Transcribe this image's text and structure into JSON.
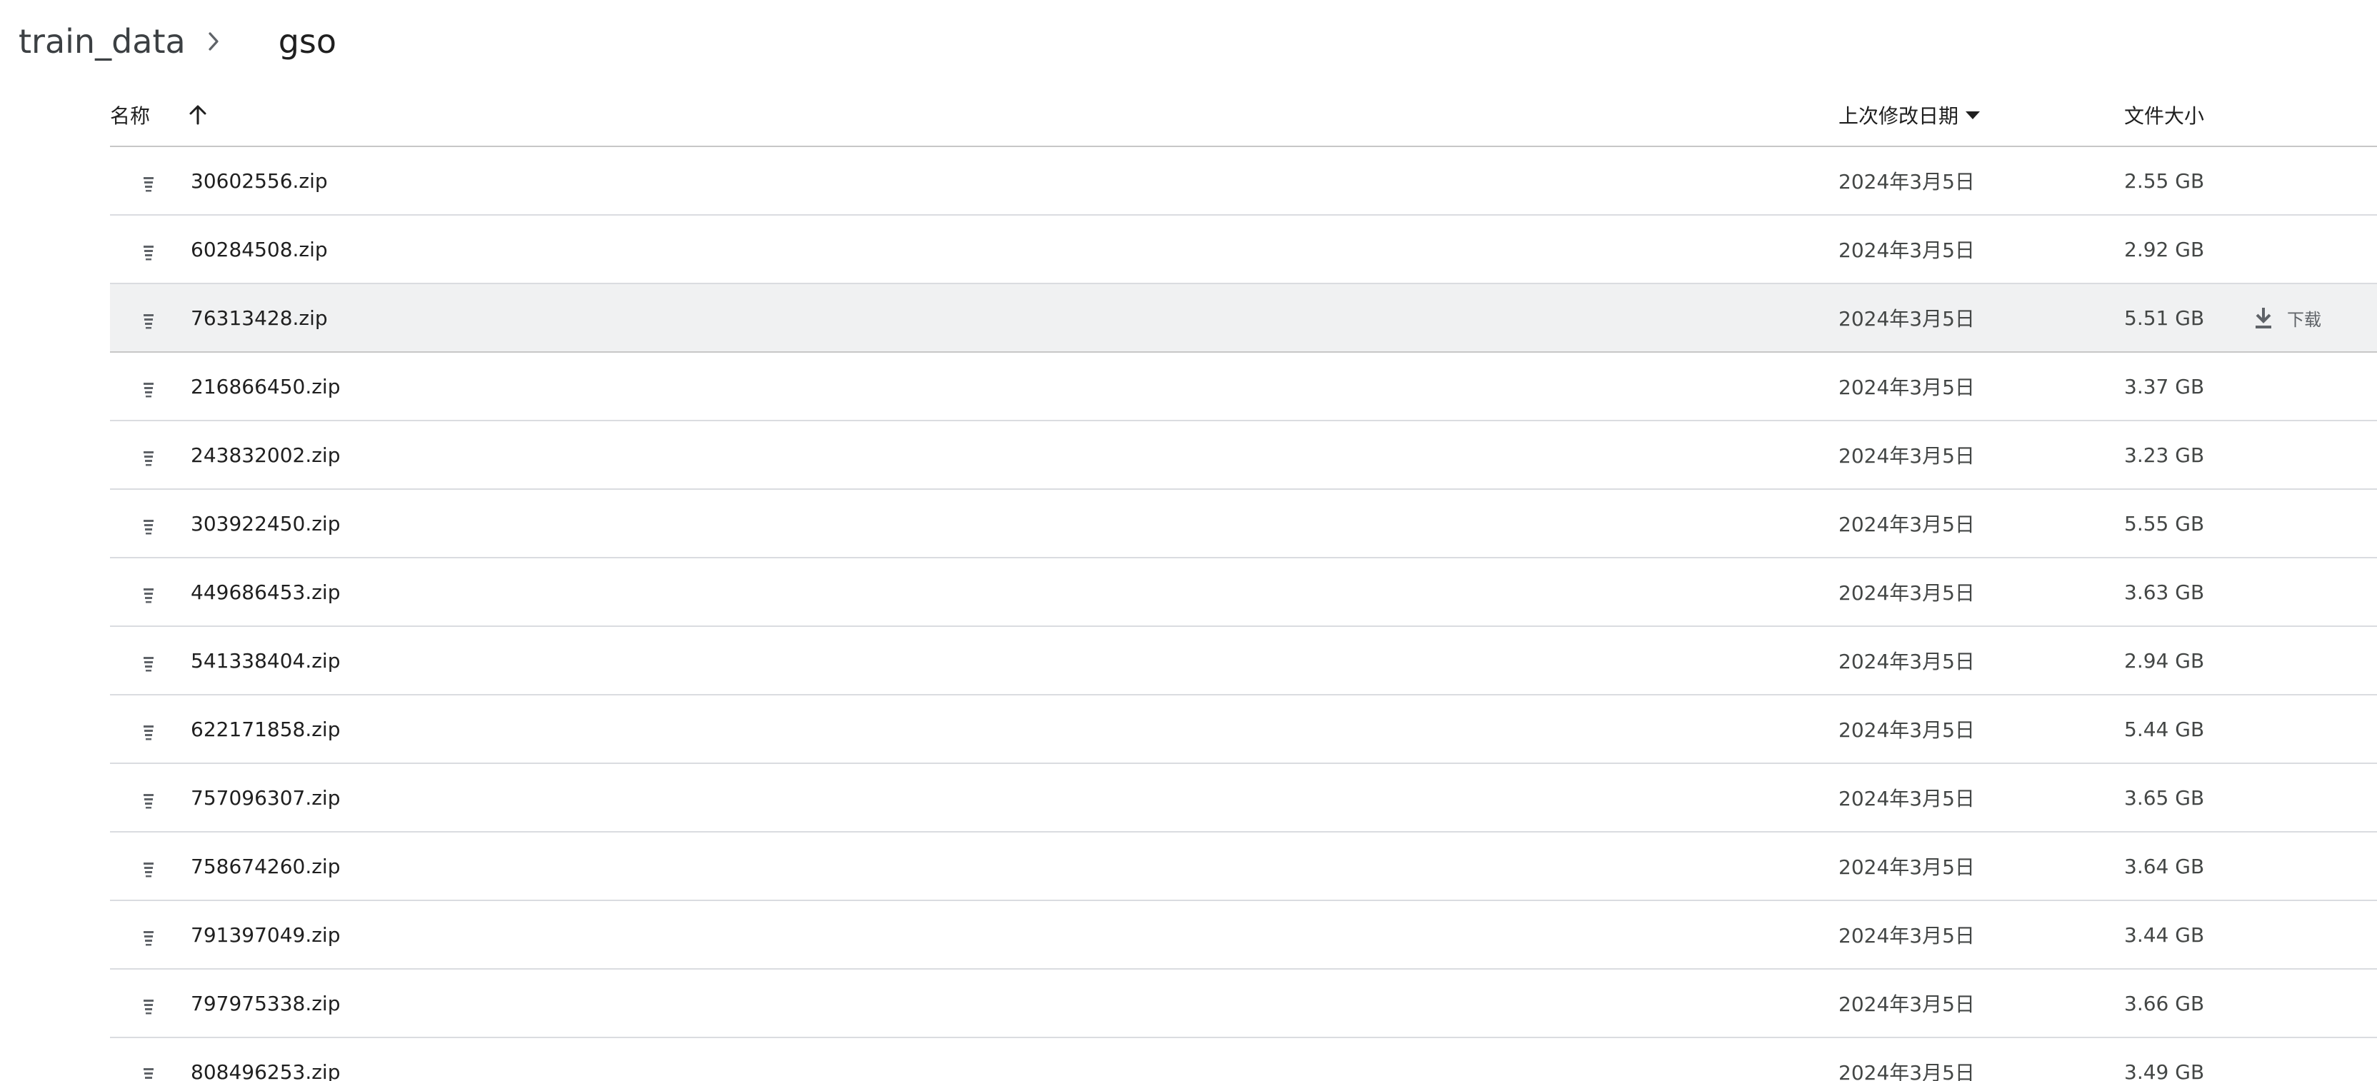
{
  "breadcrumb": {
    "parent": "train_data",
    "current": "gso"
  },
  "table": {
    "headers": {
      "name": "名称",
      "modified": "上次修改日期",
      "size": "文件大小"
    },
    "download_label": "下载",
    "rows": [
      {
        "name": "30602556.zip",
        "modified": "2024年3月5日",
        "size": "2.55 GB"
      },
      {
        "name": "60284508.zip",
        "modified": "2024年3月5日",
        "size": "2.92 GB"
      },
      {
        "name": "76313428.zip",
        "modified": "2024年3月5日",
        "size": "5.51 GB"
      },
      {
        "name": "216866450.zip",
        "modified": "2024年3月5日",
        "size": "3.37 GB"
      },
      {
        "name": "243832002.zip",
        "modified": "2024年3月5日",
        "size": "3.23 GB"
      },
      {
        "name": "303922450.zip",
        "modified": "2024年3月5日",
        "size": "5.55 GB"
      },
      {
        "name": "449686453.zip",
        "modified": "2024年3月5日",
        "size": "3.63 GB"
      },
      {
        "name": "541338404.zip",
        "modified": "2024年3月5日",
        "size": "2.94 GB"
      },
      {
        "name": "622171858.zip",
        "modified": "2024年3月5日",
        "size": "5.44 GB"
      },
      {
        "name": "757096307.zip",
        "modified": "2024年3月5日",
        "size": "3.65 GB"
      },
      {
        "name": "758674260.zip",
        "modified": "2024年3月5日",
        "size": "3.64 GB"
      },
      {
        "name": "791397049.zip",
        "modified": "2024年3月5日",
        "size": "3.44 GB"
      },
      {
        "name": "797975338.zip",
        "modified": "2024年3月5日",
        "size": "3.66 GB"
      },
      {
        "name": "808496253.zip",
        "modified": "2024年3月5日",
        "size": "3.49 GB"
      }
    ]
  },
  "icons": {
    "breadcrumb_separator": "chevron-right-icon",
    "sort": "arrow-up-icon",
    "sort_dropdown": "caret-down-icon",
    "file": "zip-file-icon",
    "download": "download-icon"
  },
  "colors": {
    "row_hover": "#f0f1f2",
    "divider": "#dadce0",
    "text_primary": "#1f1f1f",
    "text_secondary": "#444746"
  }
}
